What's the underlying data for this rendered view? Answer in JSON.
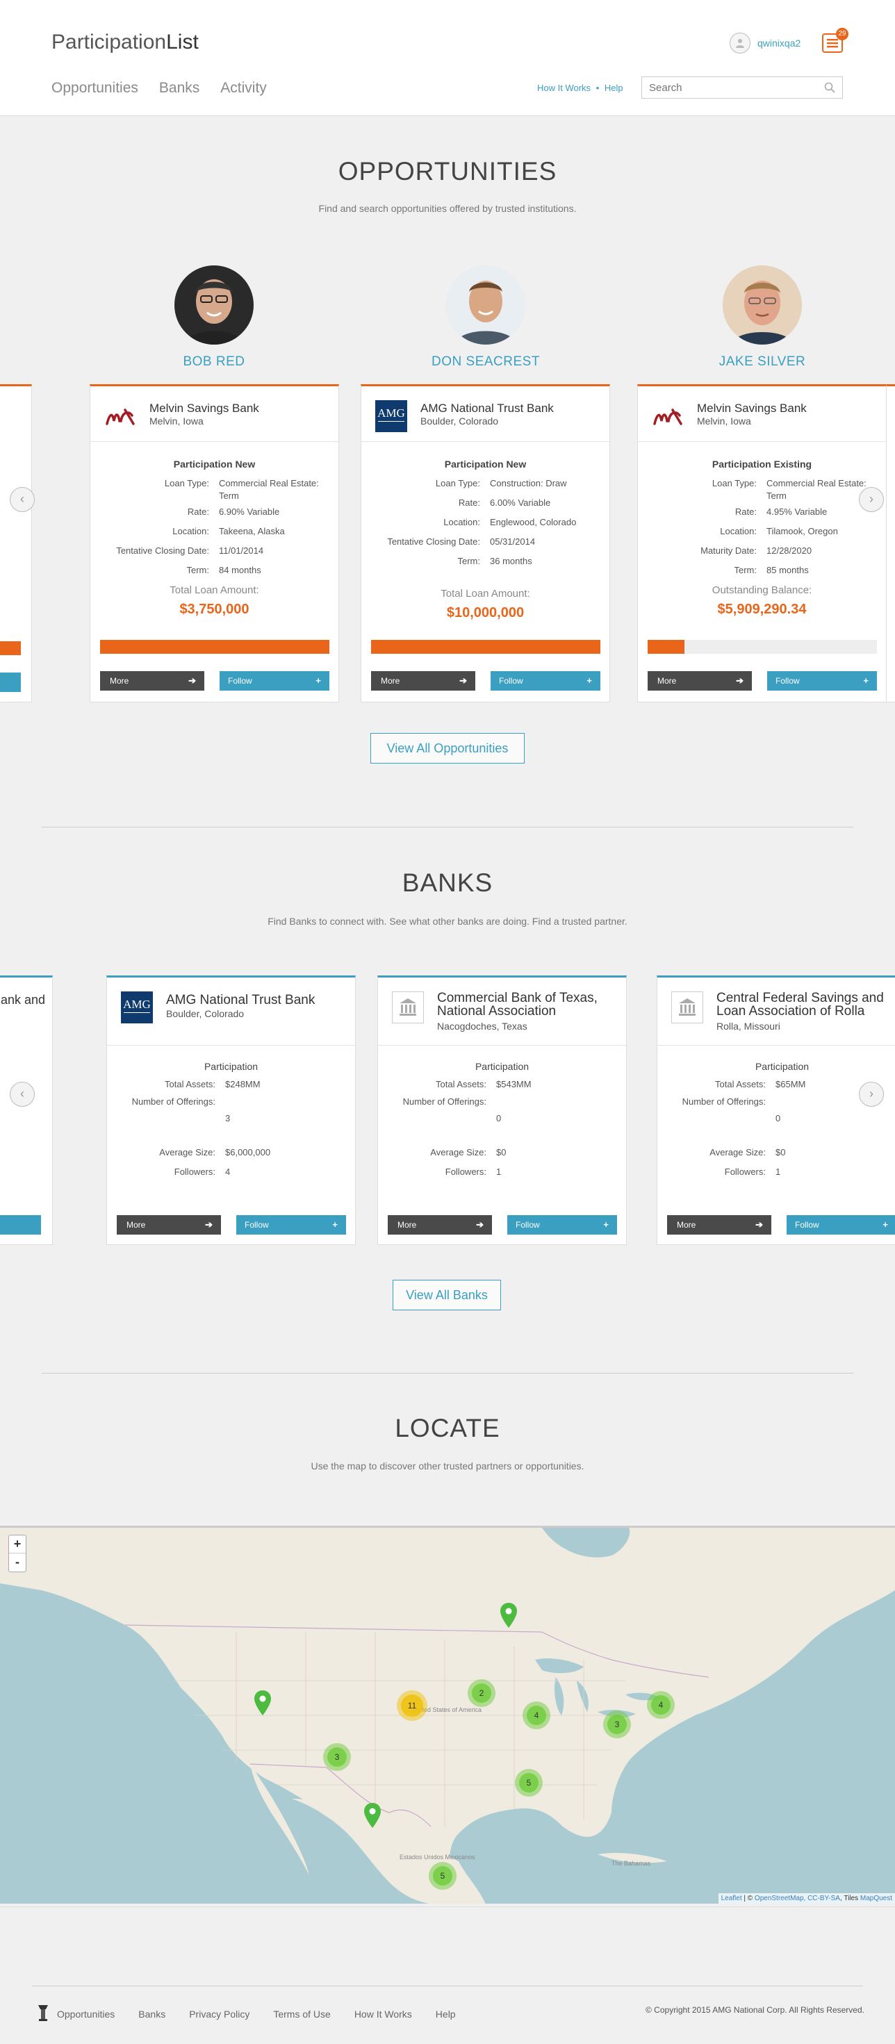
{
  "header": {
    "logo_light": "Participation",
    "logo_bold": "List",
    "nav": [
      "Opportunities",
      "Banks",
      "Activity"
    ],
    "username": "qwinixqa2",
    "notif_count": "29",
    "help_link_1": "How It Works",
    "help_sep": "•",
    "help_link_2": "Help",
    "search_placeholder": "Search"
  },
  "opportunities": {
    "title": "OPPORTUNITIES",
    "subtitle": "Find and search opportunities offered by trusted institutions.",
    "profiles": [
      "BOB RED",
      "DON SEACREST",
      "JAKE SILVER"
    ],
    "cards": [
      {
        "bank": "Melvin Savings Bank",
        "location": "Melvin, Iowa",
        "type": "Participation New",
        "rows": [
          {
            "k": "Loan Type:",
            "v": "Commercial Real Estate: Term"
          },
          {
            "k": "Rate:",
            "v": "6.90% Variable"
          },
          {
            "k": "Location:",
            "v": "Takeena, Alaska"
          },
          {
            "k": "Tentative Closing Date:",
            "v": "11/01/2014"
          },
          {
            "k": "Term:",
            "v": "84 months"
          }
        ],
        "amount_label": "Total Loan Amount:",
        "amount": "$3,750,000",
        "progress": 1.0
      },
      {
        "bank": "AMG National Trust Bank",
        "location": "Boulder, Colorado",
        "type": "Participation New",
        "rows": [
          {
            "k": "Loan Type:",
            "v": "Construction: Draw"
          },
          {
            "k": "Rate:",
            "v": "6.00% Variable"
          },
          {
            "k": "Location:",
            "v": "Englewood, Colorado"
          },
          {
            "k": "Tentative Closing Date:",
            "v": "05/31/2014"
          },
          {
            "k": "Term:",
            "v": "36 months"
          }
        ],
        "amount_label": "Total Loan Amount:",
        "amount": "$10,000,000",
        "progress": 1.0
      },
      {
        "bank": "Melvin Savings Bank",
        "location": "Melvin, Iowa",
        "type": "Participation Existing",
        "rows": [
          {
            "k": "Loan Type:",
            "v": "Commercial Real Estate: Term"
          },
          {
            "k": "Rate:",
            "v": "4.95% Variable"
          },
          {
            "k": "Location:",
            "v": "Tilamook, Oregon"
          },
          {
            "k": "Maturity Date:",
            "v": "12/28/2020"
          },
          {
            "k": "Term:",
            "v": "85 months"
          }
        ],
        "amount_label": "Outstanding Balance:",
        "amount": "$5,909,290.34",
        "progress": 0.16
      }
    ],
    "more_label": "More",
    "follow_label": "Follow",
    "view_all": "View All Opportunities"
  },
  "banks": {
    "title": "BANKS",
    "subtitle": "Find Banks to connect with. See what other banks are doing. Find a trusted partner.",
    "partial_left": "ank and",
    "cards": [
      {
        "bank": "AMG National Trust Bank",
        "location": "Boulder, Colorado",
        "type": "Participation",
        "assets": "$248MM",
        "offerings": "3",
        "avg": "$6,000,000",
        "followers": "4"
      },
      {
        "bank": "Commercial Bank of Texas, National Association",
        "location": "Nacogdoches, Texas",
        "type": "Participation",
        "assets": "$543MM",
        "offerings": "0",
        "avg": "$0",
        "followers": "1"
      },
      {
        "bank": "Central Federal Savings and Loan Association of Rolla",
        "location": "Rolla, Missouri",
        "type": "Participation",
        "assets": "$65MM",
        "offerings": "0",
        "avg": "$0",
        "followers": "1"
      }
    ],
    "labels": {
      "assets": "Total Assets:",
      "offerings": "Number of Offerings:",
      "avg": "Average Size:",
      "followers": "Followers:"
    },
    "view_all": "View All Banks"
  },
  "locate": {
    "title": "LOCATE",
    "subtitle": "Use the map to discover other trusted partners or opportunities.",
    "zoom_in": "+",
    "zoom_out": "-",
    "clusters": [
      "2",
      "11",
      "4",
      "3",
      "4",
      "3",
      "5",
      "5"
    ],
    "labels": {
      "usa": "United States of America",
      "mexico": "Estados Unidos Mexicanos",
      "bahamas": "The Bahamas"
    },
    "attribution": {
      "leaflet": "Leaflet",
      "sep": " | © ",
      "osm": "OpenStreetMap",
      "cc": ", CC-BY-SA",
      "tiles": ", Tiles ",
      "mq": "MapQuest"
    }
  },
  "footer": {
    "links": [
      "Opportunities",
      "Banks",
      "Privacy Policy",
      "Terms of Use",
      "How It Works",
      "Help"
    ],
    "copyright": "© Copyright 2015 AMG National Corp. All Rights Reserved."
  }
}
